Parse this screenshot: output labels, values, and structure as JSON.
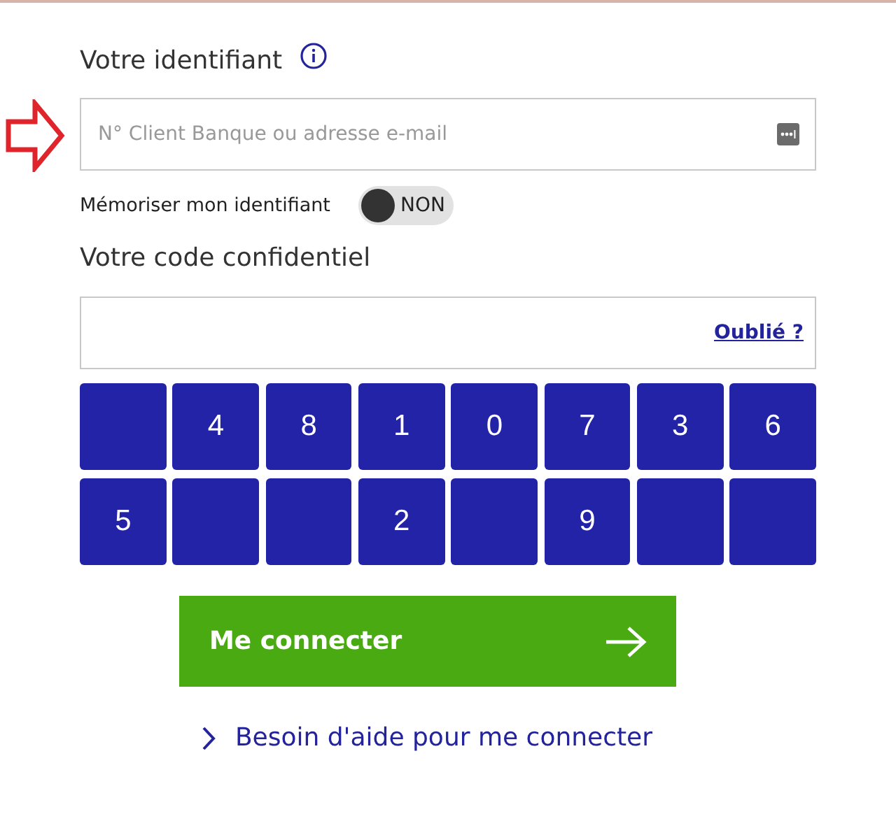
{
  "identifier": {
    "label": "Votre identifiant",
    "placeholder": "N° Client Banque ou adresse e-mail"
  },
  "remember": {
    "label": "Mémoriser mon identifiant",
    "on": false,
    "state_text": "NON"
  },
  "code": {
    "label": "Votre code confidentiel",
    "forgot_link": "Oublié ?"
  },
  "keypad": [
    {
      "kind": "blank"
    },
    {
      "kind": "digit",
      "label": "4"
    },
    {
      "kind": "digit",
      "label": "8"
    },
    {
      "kind": "digit",
      "label": "1"
    },
    {
      "kind": "digit",
      "label": "0"
    },
    {
      "kind": "digit",
      "label": "7"
    },
    {
      "kind": "digit",
      "label": "3"
    },
    {
      "kind": "digit",
      "label": "6"
    },
    {
      "kind": "digit",
      "label": "5"
    },
    {
      "kind": "blank"
    },
    {
      "kind": "blank"
    },
    {
      "kind": "digit",
      "label": "2"
    },
    {
      "kind": "blank"
    },
    {
      "kind": "digit",
      "label": "9"
    },
    {
      "kind": "blank"
    },
    {
      "kind": "blank"
    }
  ],
  "submit_button": "Me connecter",
  "help_link": "Besoin d'aide pour me connecter"
}
